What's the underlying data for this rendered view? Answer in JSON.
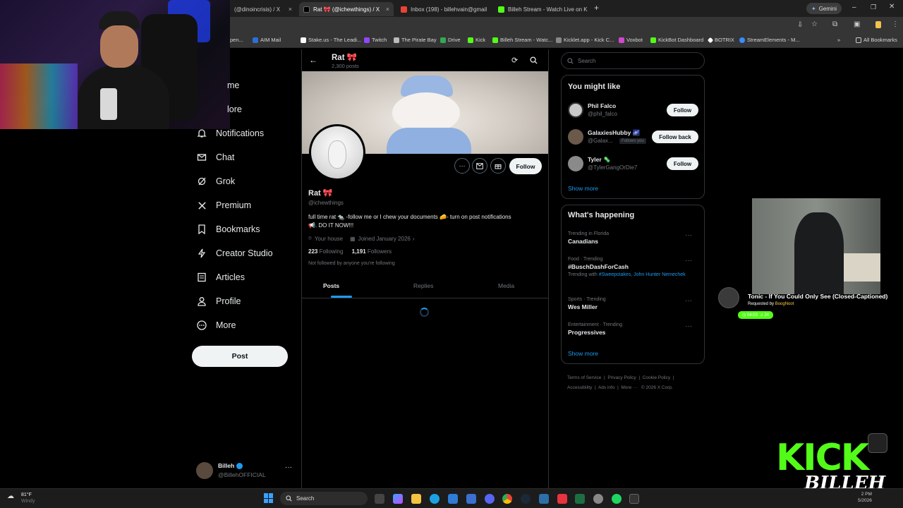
{
  "browser": {
    "tabs": [
      {
        "label": "(@dinoincrisis) / X",
        "color": "#ffffff"
      },
      {
        "label": "Rat 🎀 (@ichewthings) / X",
        "color": "#ffffff"
      },
      {
        "label": "Inbox (198) - billehvain@gmail",
        "color": "#ea4335"
      },
      {
        "label": "Billeh Stream - Watch Live on K",
        "color": "#53fc18"
      }
    ],
    "gemini_label": "Gemini",
    "bookmarks": [
      {
        "label": "AIM Mail",
        "color": "#2b6fd8"
      },
      {
        "label": "Stake.us - The Leadi...",
        "color": "#ffffff"
      },
      {
        "label": "Twitch",
        "color": "#9146ff"
      },
      {
        "label": "The Pirate Bay",
        "color": "#bbbbbb"
      },
      {
        "label": "Drive",
        "color": "#34a853"
      },
      {
        "label": "Kick",
        "color": "#53fc18"
      },
      {
        "label": "Billeh Stream - Watc...",
        "color": "#53fc18"
      },
      {
        "label": "Kicklet.app - Kick C...",
        "color": "#888888"
      },
      {
        "label": "Voxbot",
        "color": "#d048d0"
      },
      {
        "label": "KickBot Dashboard",
        "color": "#53fc18"
      },
      {
        "label": "BOTRIX",
        "color": "#ffffff"
      },
      {
        "label": "StreamElements - M...",
        "color": "#3a8bff"
      }
    ],
    "bookmarks_partial": "pen...",
    "all_bookmarks": "All Bookmarks"
  },
  "nav": {
    "partial_home": "me",
    "partial_explore": "lore",
    "items": [
      "Notifications",
      "Chat",
      "Grok",
      "Premium",
      "Bookmarks",
      "Creator Studio",
      "Articles",
      "Profile",
      "More"
    ],
    "post_button": "Post",
    "account_name": "Billeh",
    "account_handle": "@BillehOFFICIAL"
  },
  "profile": {
    "header_name": "Rat 🎀",
    "post_count": "2,300 posts",
    "name": "Rat 🎀",
    "handle": "@ichewthings",
    "bio_line1": "full time rat 🐀 -follow me or I chew your documents 🧀- turn on post notifications",
    "bio_line2": "📢. DO IT NOW!!!",
    "location": "Your house",
    "joined": "Joined January 2026",
    "following_count": "223",
    "following_label": "Following",
    "followers_count": "1,191",
    "followers_label": "Followers",
    "not_followed": "Not followed by anyone you're following",
    "follow_label": "Follow",
    "tabs": [
      "Posts",
      "Replies",
      "Media"
    ]
  },
  "sidebar": {
    "search_placeholder": "Search",
    "you_might_like_title": "You might like",
    "suggestions": [
      {
        "name": "Phil Falco",
        "handle": "@phil_falco",
        "button": "Follow",
        "badge": ""
      },
      {
        "name": "GalaxiesHubby 🌌",
        "handle": "@Galax...",
        "button": "Follow back",
        "badge": "Follows you"
      },
      {
        "name": "Tyler 🦠",
        "handle": "@TylerGangOrDie7",
        "button": "Follow",
        "badge": ""
      }
    ],
    "show_more": "Show more",
    "whats_happening_title": "What's happening",
    "trends": [
      {
        "context": "Trending in Florida",
        "title": "Canadians",
        "extra_prefix": "",
        "extra": ""
      },
      {
        "context": "Food · Trending",
        "title": "#BuschDashForCash",
        "extra_prefix": "Trending with",
        "extra": "#Sweepstakes, John Hunter Nemechek"
      },
      {
        "context": "Sports · Trending",
        "title": "Wes Miller",
        "extra_prefix": "",
        "extra": ""
      },
      {
        "context": "Entertainment · Trending",
        "title": "Progressives",
        "extra_prefix": "",
        "extra": ""
      }
    ],
    "show_more_2": "Show more",
    "footer_line1": [
      "Terms of Service",
      "Privacy Policy",
      "Cookie Policy"
    ],
    "footer_line2": [
      "Accessibility",
      "Ads info",
      "More ···",
      "© 2026 X Corp."
    ]
  },
  "overlay": {
    "song_title": "Tonic - If You Could Only See (Closed-Captioned)",
    "requested_prefix": "Requested by",
    "requested_by": "BoogNoot",
    "time_badge": "04:03",
    "queue_badge": "24",
    "kick_text": "KICK",
    "kick_signature": "BILLEH"
  },
  "taskbar": {
    "weather_temp": "81°F",
    "weather_desc": "Windy",
    "search_label": "Search",
    "clock_time": "2 PM",
    "clock_date": "5/2026"
  },
  "colors": {
    "accent_blue": "#1d9bf0",
    "kick_green": "#53fc18"
  }
}
